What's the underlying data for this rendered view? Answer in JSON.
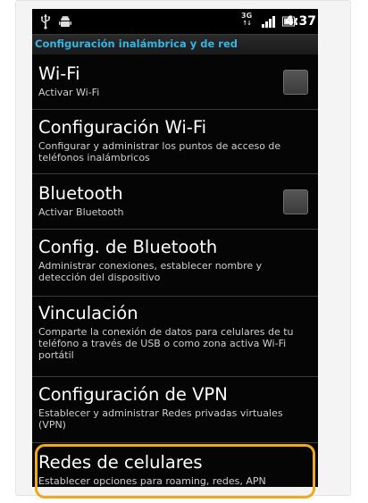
{
  "status": {
    "network_type": "3G",
    "clock": "4:37"
  },
  "header": {
    "title": "Configuración inalámbrica y de red"
  },
  "items": [
    {
      "title": "Wi-Fi",
      "subtitle": "Activar Wi-Fi",
      "has_checkbox": true
    },
    {
      "title": "Configuración Wi-Fi",
      "subtitle": "Configurar y administrar los puntos de acceso de teléfonos inalámbricos",
      "has_checkbox": false
    },
    {
      "title": "Bluetooth",
      "subtitle": "Activar Bluetooth",
      "has_checkbox": true
    },
    {
      "title": "Config. de Bluetooth",
      "subtitle": "Administrar conexiones, establecer nombre y detección del dispositivo",
      "has_checkbox": false
    },
    {
      "title": "Vinculación",
      "subtitle": "Comparte la conexión de datos para celulares de tu teléfono a través de USB o como zona activa Wi-Fi portátil",
      "has_checkbox": false
    },
    {
      "title": "Configuración de VPN",
      "subtitle": "Establecer y administrar Redes privadas virtuales (VPN)",
      "has_checkbox": false
    },
    {
      "title": "Redes de celulares",
      "subtitle": "Establecer opciones para roaming, redes, APN",
      "has_checkbox": false
    }
  ],
  "colors": {
    "header_text": "#33b5e5",
    "highlight": "#f0a81c",
    "background": "#050505"
  }
}
